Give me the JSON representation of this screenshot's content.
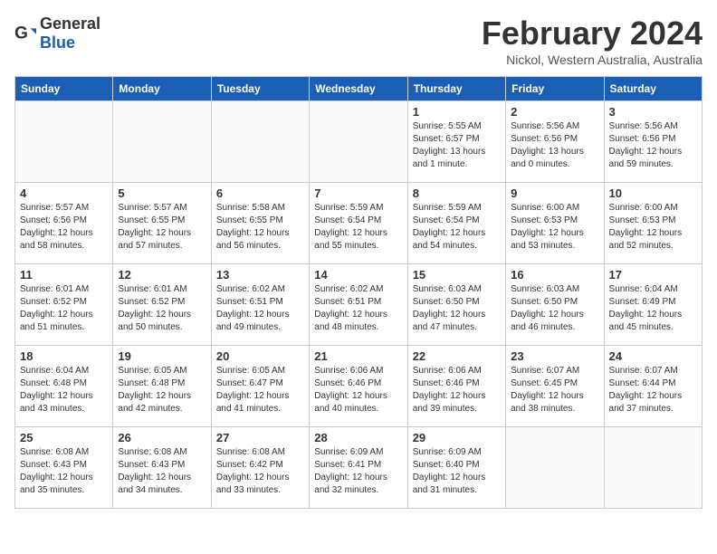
{
  "header": {
    "logo_general": "General",
    "logo_blue": "Blue",
    "title": "February 2024",
    "subtitle": "Nickol, Western Australia, Australia"
  },
  "days_of_week": [
    "Sunday",
    "Monday",
    "Tuesday",
    "Wednesday",
    "Thursday",
    "Friday",
    "Saturday"
  ],
  "weeks": [
    [
      {
        "day": "",
        "empty": true
      },
      {
        "day": "",
        "empty": true
      },
      {
        "day": "",
        "empty": true
      },
      {
        "day": "",
        "empty": true
      },
      {
        "day": "1",
        "sunrise": "5:55 AM",
        "sunset": "6:57 PM",
        "daylight": "13 hours and 1 minute."
      },
      {
        "day": "2",
        "sunrise": "5:56 AM",
        "sunset": "6:56 PM",
        "daylight": "13 hours and 0 minutes."
      },
      {
        "day": "3",
        "sunrise": "5:56 AM",
        "sunset": "6:56 PM",
        "daylight": "12 hours and 59 minutes."
      }
    ],
    [
      {
        "day": "4",
        "sunrise": "5:57 AM",
        "sunset": "6:56 PM",
        "daylight": "12 hours and 58 minutes."
      },
      {
        "day": "5",
        "sunrise": "5:57 AM",
        "sunset": "6:55 PM",
        "daylight": "12 hours and 57 minutes."
      },
      {
        "day": "6",
        "sunrise": "5:58 AM",
        "sunset": "6:55 PM",
        "daylight": "12 hours and 56 minutes."
      },
      {
        "day": "7",
        "sunrise": "5:59 AM",
        "sunset": "6:54 PM",
        "daylight": "12 hours and 55 minutes."
      },
      {
        "day": "8",
        "sunrise": "5:59 AM",
        "sunset": "6:54 PM",
        "daylight": "12 hours and 54 minutes."
      },
      {
        "day": "9",
        "sunrise": "6:00 AM",
        "sunset": "6:53 PM",
        "daylight": "12 hours and 53 minutes."
      },
      {
        "day": "10",
        "sunrise": "6:00 AM",
        "sunset": "6:53 PM",
        "daylight": "12 hours and 52 minutes."
      }
    ],
    [
      {
        "day": "11",
        "sunrise": "6:01 AM",
        "sunset": "6:52 PM",
        "daylight": "12 hours and 51 minutes."
      },
      {
        "day": "12",
        "sunrise": "6:01 AM",
        "sunset": "6:52 PM",
        "daylight": "12 hours and 50 minutes."
      },
      {
        "day": "13",
        "sunrise": "6:02 AM",
        "sunset": "6:51 PM",
        "daylight": "12 hours and 49 minutes."
      },
      {
        "day": "14",
        "sunrise": "6:02 AM",
        "sunset": "6:51 PM",
        "daylight": "12 hours and 48 minutes."
      },
      {
        "day": "15",
        "sunrise": "6:03 AM",
        "sunset": "6:50 PM",
        "daylight": "12 hours and 47 minutes."
      },
      {
        "day": "16",
        "sunrise": "6:03 AM",
        "sunset": "6:50 PM",
        "daylight": "12 hours and 46 minutes."
      },
      {
        "day": "17",
        "sunrise": "6:04 AM",
        "sunset": "6:49 PM",
        "daylight": "12 hours and 45 minutes."
      }
    ],
    [
      {
        "day": "18",
        "sunrise": "6:04 AM",
        "sunset": "6:48 PM",
        "daylight": "12 hours and 43 minutes."
      },
      {
        "day": "19",
        "sunrise": "6:05 AM",
        "sunset": "6:48 PM",
        "daylight": "12 hours and 42 minutes."
      },
      {
        "day": "20",
        "sunrise": "6:05 AM",
        "sunset": "6:47 PM",
        "daylight": "12 hours and 41 minutes."
      },
      {
        "day": "21",
        "sunrise": "6:06 AM",
        "sunset": "6:46 PM",
        "daylight": "12 hours and 40 minutes."
      },
      {
        "day": "22",
        "sunrise": "6:06 AM",
        "sunset": "6:46 PM",
        "daylight": "12 hours and 39 minutes."
      },
      {
        "day": "23",
        "sunrise": "6:07 AM",
        "sunset": "6:45 PM",
        "daylight": "12 hours and 38 minutes."
      },
      {
        "day": "24",
        "sunrise": "6:07 AM",
        "sunset": "6:44 PM",
        "daylight": "12 hours and 37 minutes."
      }
    ],
    [
      {
        "day": "25",
        "sunrise": "6:08 AM",
        "sunset": "6:43 PM",
        "daylight": "12 hours and 35 minutes."
      },
      {
        "day": "26",
        "sunrise": "6:08 AM",
        "sunset": "6:43 PM",
        "daylight": "12 hours and 34 minutes."
      },
      {
        "day": "27",
        "sunrise": "6:08 AM",
        "sunset": "6:42 PM",
        "daylight": "12 hours and 33 minutes."
      },
      {
        "day": "28",
        "sunrise": "6:09 AM",
        "sunset": "6:41 PM",
        "daylight": "12 hours and 32 minutes."
      },
      {
        "day": "29",
        "sunrise": "6:09 AM",
        "sunset": "6:40 PM",
        "daylight": "12 hours and 31 minutes."
      },
      {
        "day": "",
        "empty": true
      },
      {
        "day": "",
        "empty": true
      }
    ]
  ]
}
